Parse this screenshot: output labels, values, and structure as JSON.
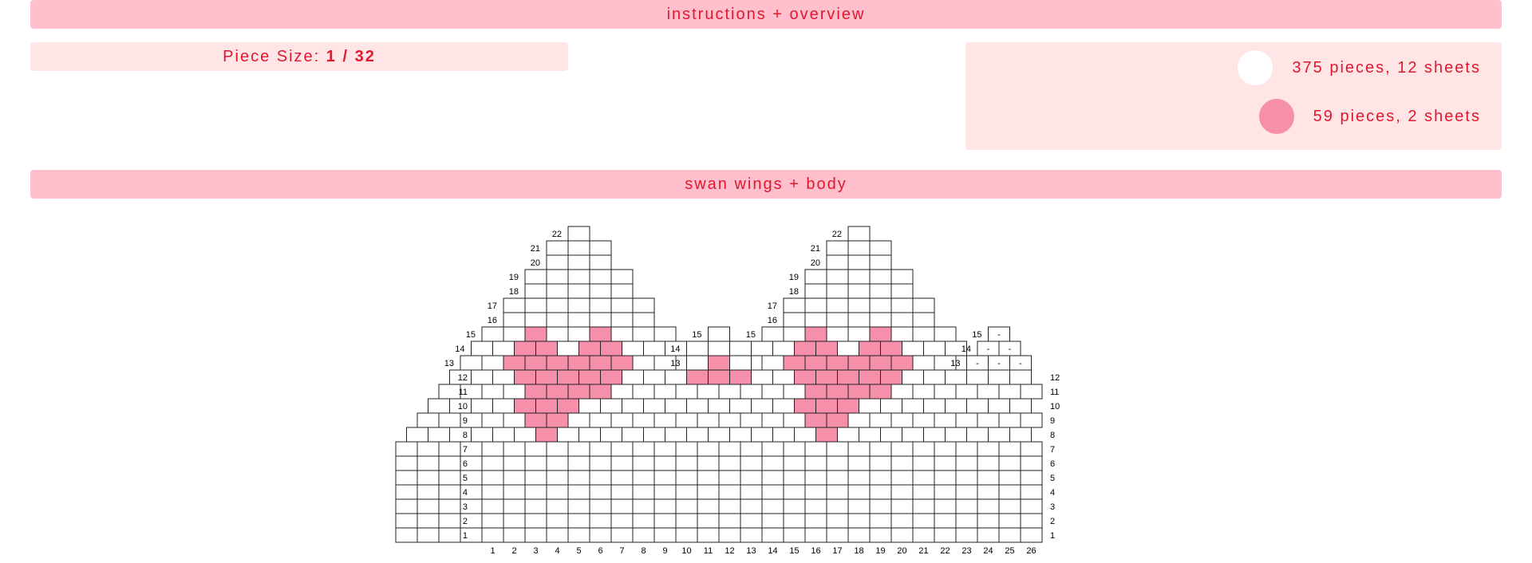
{
  "header": {
    "title": "instructions + overview"
  },
  "piece_size": {
    "label": "Piece Size: ",
    "value": "1 / 32"
  },
  "legend": [
    {
      "color": "#ffffff",
      "text": "375 pieces, 12 sheets"
    },
    {
      "color": "#f68fa9",
      "text": "59 pieces, 2 sheets"
    }
  ],
  "section": {
    "title": "swan wings + body"
  },
  "colors": {
    "bar": "#ffbfcc",
    "panel": "#ffe5e6",
    "text": "#e0182f",
    "pink": "#f68fa9",
    "white": "#ffffff"
  },
  "pattern": {
    "column_labels": [
      "1",
      "2",
      "3",
      "4",
      "5",
      "6",
      "7",
      "8",
      "9",
      "10",
      "11",
      "12",
      "13",
      "14",
      "15",
      "16",
      "17",
      "18",
      "19",
      "20",
      "21",
      "22",
      "23",
      "24",
      "25",
      "26"
    ],
    "wings": [
      {
        "rows": [
          {
            "label": "22",
            "cells": "W"
          },
          {
            "label": "21",
            "cells": "WWW"
          },
          {
            "label": "20",
            "cells": "WWW"
          },
          {
            "label": "19",
            "cells": "WWWWW"
          },
          {
            "label": "18",
            "cells": "WWWWW"
          },
          {
            "label": "17",
            "cells": "WWWWWWW"
          },
          {
            "label": "16",
            "cells": "WWWWWWW"
          },
          {
            "label": "15",
            "cells": "WWPWWPWWW"
          },
          {
            "label": "14",
            "cells": "WWPPWPPWWW"
          },
          {
            "label": "13",
            "cells": "WWPPPPPPWWW"
          },
          {
            "label": "12",
            "cells": "WWWPPPPPWWWW"
          },
          {
            "label": "11",
            "cells": "WWWWPPPPWWWWW"
          },
          {
            "label": "10",
            "cells": "WWWWPPPWWWWWWW"
          },
          {
            "label": "9",
            "cells": "WWWWWPPWWWWWWWW"
          },
          {
            "label": "8",
            "cells": "WWWWWWPWWWWWWWWW"
          },
          {
            "label": "7",
            "cells": "WWWWWWWWWWWWWWWWW"
          },
          {
            "label": "6",
            "cells": "WWWWWWWWWWWWWWWWW"
          },
          {
            "label": "5",
            "cells": "WWWWWWWWWWWWWWWWW"
          },
          {
            "label": "4",
            "cells": "WWWWWWWWWWWWWWWWW"
          },
          {
            "label": "3",
            "cells": "WWWWWWWWWWWWWWWWW"
          },
          {
            "label": "2",
            "cells": "WWWWWWWWWWWWWWWWW"
          },
          {
            "label": "1",
            "cells": "WWWWWWWWWWWWWWWWW"
          }
        ]
      }
    ],
    "middle_rows": [
      {
        "label": "15",
        "cells": "W"
      },
      {
        "label": "14",
        "cells": "WWW"
      },
      {
        "label": "13",
        "cells": "WPW"
      },
      {
        "label": "12",
        "cells": "PPP"
      }
    ],
    "corner_rows": [
      {
        "label": "15",
        "cells": "-"
      },
      {
        "label": "14",
        "cells": "--"
      },
      {
        "label": "13",
        "cells": "---"
      }
    ]
  }
}
